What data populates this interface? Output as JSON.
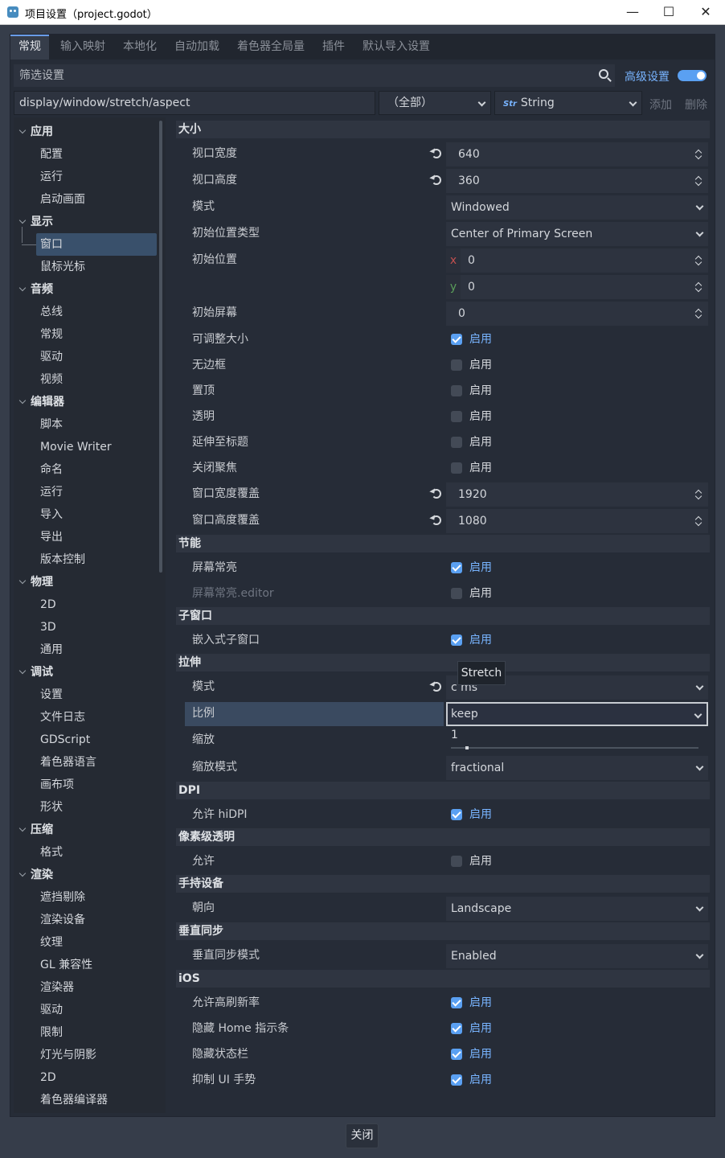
{
  "window": {
    "title": "项目设置（project.godot）",
    "minimize": "—",
    "maximize": "☐",
    "close": "✕"
  },
  "tabs": [
    "常规",
    "输入映射",
    "本地化",
    "自动加载",
    "着色器全局量",
    "插件",
    "默认导入设置"
  ],
  "filter": {
    "placeholder": "筛选设置"
  },
  "advanced": {
    "label": "高级设置",
    "on": true
  },
  "path": {
    "value": "display/window/stretch/aspect"
  },
  "category_select": "（全部）",
  "type_select": "String",
  "type_icon": "Str",
  "add_button": "添加",
  "delete_button": "删除",
  "tree": [
    {
      "label": "应用",
      "cat": true
    },
    {
      "label": "配置"
    },
    {
      "label": "运行"
    },
    {
      "label": "启动画面"
    },
    {
      "label": "显示",
      "cat": true
    },
    {
      "label": "窗口",
      "selected": true
    },
    {
      "label": "鼠标光标"
    },
    {
      "label": "音频",
      "cat": true
    },
    {
      "label": "总线"
    },
    {
      "label": "常规"
    },
    {
      "label": "驱动"
    },
    {
      "label": "视频"
    },
    {
      "label": "编辑器",
      "cat": true
    },
    {
      "label": "脚本"
    },
    {
      "label": "Movie Writer"
    },
    {
      "label": "命名"
    },
    {
      "label": "运行"
    },
    {
      "label": "导入"
    },
    {
      "label": "导出"
    },
    {
      "label": "版本控制"
    },
    {
      "label": "物理",
      "cat": true
    },
    {
      "label": "2D"
    },
    {
      "label": "3D"
    },
    {
      "label": "通用"
    },
    {
      "label": "调试",
      "cat": true
    },
    {
      "label": "设置"
    },
    {
      "label": "文件日志"
    },
    {
      "label": "GDScript"
    },
    {
      "label": "着色器语言"
    },
    {
      "label": "画布项"
    },
    {
      "label": "形状"
    },
    {
      "label": "压缩",
      "cat": true
    },
    {
      "label": "格式"
    },
    {
      "label": "渲染",
      "cat": true
    },
    {
      "label": "遮挡剔除"
    },
    {
      "label": "渲染设备"
    },
    {
      "label": "纹理"
    },
    {
      "label": "GL 兼容性"
    },
    {
      "label": "渲染器"
    },
    {
      "label": "驱动"
    },
    {
      "label": "限制"
    },
    {
      "label": "灯光与阴影"
    },
    {
      "label": "2D"
    },
    {
      "label": "着色器编译器"
    }
  ],
  "enable_label": "启用",
  "props": [
    {
      "kind": "section",
      "label": "大小"
    },
    {
      "kind": "spin",
      "label": "视口宽度",
      "value": "640",
      "reset": true
    },
    {
      "kind": "spin",
      "label": "视口高度",
      "value": "360",
      "reset": true
    },
    {
      "kind": "enum",
      "label": "模式",
      "value": "Windowed"
    },
    {
      "kind": "enum",
      "label": "初始位置类型",
      "value": "Center of Primary Screen"
    },
    {
      "kind": "vec",
      "label": "初始位置",
      "axis": "x",
      "value": "0"
    },
    {
      "kind": "vec",
      "label": "",
      "axis": "y",
      "value": "0"
    },
    {
      "kind": "spin",
      "label": "初始屏幕",
      "value": "0"
    },
    {
      "kind": "check",
      "label": "可调整大小",
      "on": true
    },
    {
      "kind": "check",
      "label": "无边框",
      "on": false
    },
    {
      "kind": "check",
      "label": "置顶",
      "on": false
    },
    {
      "kind": "check",
      "label": "透明",
      "on": false
    },
    {
      "kind": "check",
      "label": "延伸至标题",
      "on": false
    },
    {
      "kind": "check",
      "label": "关闭聚焦",
      "on": false
    },
    {
      "kind": "spin",
      "label": "窗口宽度覆盖",
      "value": "1920",
      "reset": true
    },
    {
      "kind": "spin",
      "label": "窗口高度覆盖",
      "value": "1080",
      "reset": true
    },
    {
      "kind": "section",
      "label": "节能"
    },
    {
      "kind": "check",
      "label": "屏幕常亮",
      "on": true
    },
    {
      "kind": "check",
      "label": "屏幕常亮.editor",
      "on": false,
      "dim": true
    },
    {
      "kind": "section",
      "label": "子窗口"
    },
    {
      "kind": "check",
      "label": "嵌入式子窗口",
      "on": true
    },
    {
      "kind": "section",
      "label": "拉伸"
    },
    {
      "kind": "enum",
      "label": "模式",
      "value": "c ms",
      "reset": true
    },
    {
      "kind": "enum",
      "label": "比例",
      "value": "keep",
      "selected": true
    },
    {
      "kind": "slider",
      "label": "缩放",
      "value": "1",
      "fill": 0.06
    },
    {
      "kind": "enum",
      "label": "缩放模式",
      "value": "fractional"
    },
    {
      "kind": "section",
      "label": "DPI"
    },
    {
      "kind": "check",
      "label": "允许 hiDPI",
      "on": true
    },
    {
      "kind": "section",
      "label": "像素级透明"
    },
    {
      "kind": "check",
      "label": "允许",
      "on": false
    },
    {
      "kind": "section",
      "label": "手持设备"
    },
    {
      "kind": "enum",
      "label": "朝向",
      "value": "Landscape"
    },
    {
      "kind": "section",
      "label": "垂直同步"
    },
    {
      "kind": "enum",
      "label": "垂直同步模式",
      "value": "Enabled"
    },
    {
      "kind": "section",
      "label": "iOS"
    },
    {
      "kind": "check",
      "label": "允许高刷新率",
      "on": true
    },
    {
      "kind": "check",
      "label": "隐藏 Home 指示条",
      "on": true
    },
    {
      "kind": "check",
      "label": "隐藏状态栏",
      "on": true
    },
    {
      "kind": "check",
      "label": "抑制 UI 手势",
      "on": true
    }
  ],
  "tooltip": "Stretch",
  "close_button": "关闭"
}
